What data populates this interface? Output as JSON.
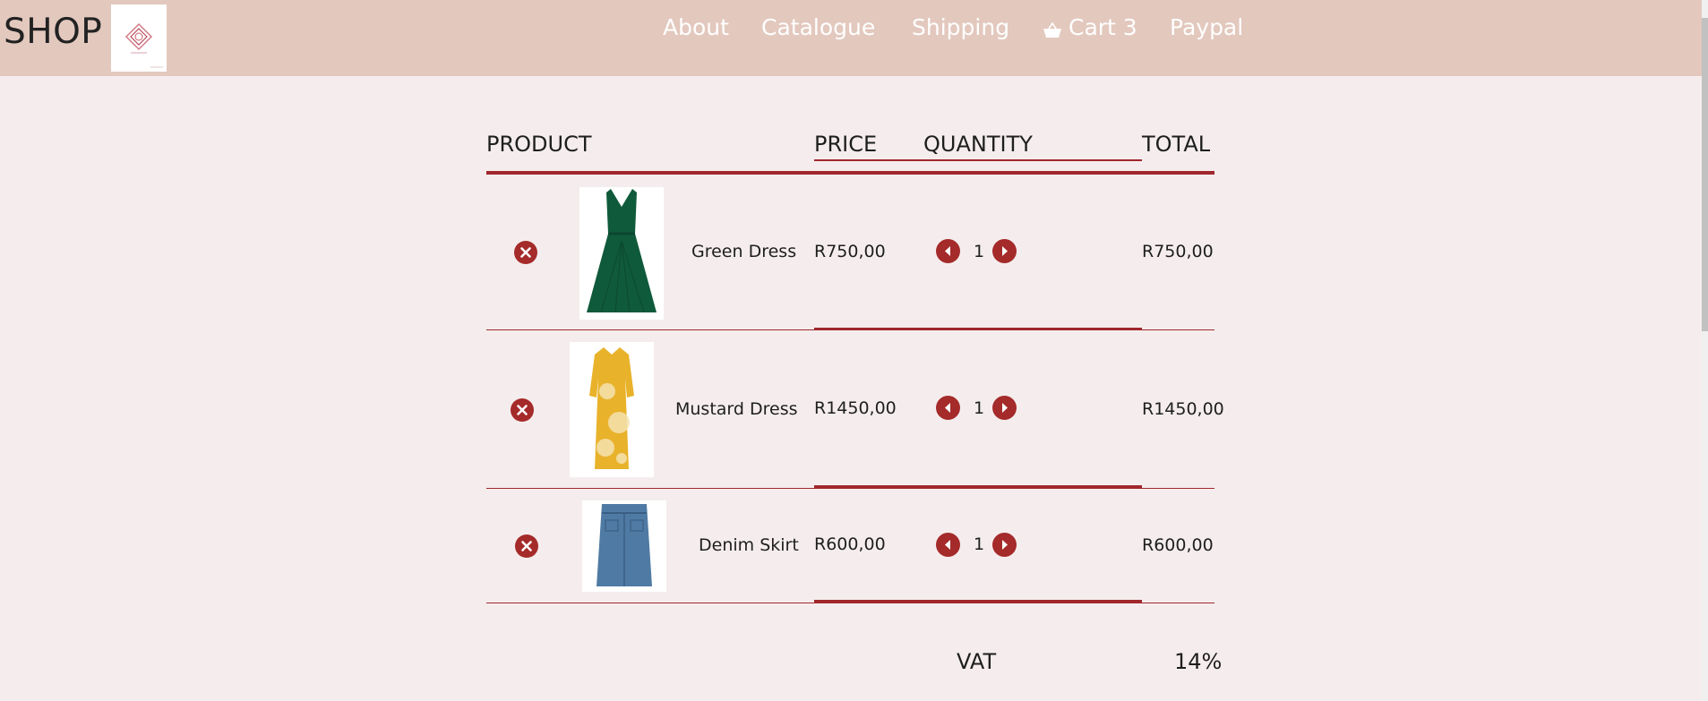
{
  "navbar": {
    "brand": "SHOP",
    "links": {
      "about": "About",
      "catalogue": "Catalogue",
      "shipping": "Shipping",
      "cart": "Cart 3",
      "paypal": "Paypal"
    }
  },
  "table": {
    "headers": {
      "product": "PRODUCT",
      "price": "PRICE",
      "quantity": "QUANTITY",
      "total": "TOTAL"
    },
    "rows": [
      {
        "name": "Green Dress",
        "price": "R750,00",
        "quantity": "1",
        "total": "R750,00",
        "image_color": "#0f5a3a"
      },
      {
        "name": "Mustard Dress",
        "price": "R1450,00",
        "quantity": "1",
        "total": "R1450,00",
        "image_color": "#e8b22a"
      },
      {
        "name": "Denim Skirt",
        "price": "R600,00",
        "quantity": "1",
        "total": "R600,00",
        "image_color": "#4f7aa3"
      }
    ]
  },
  "summary": {
    "vat_label": "VAT",
    "vat_value": "14%"
  },
  "theme": {
    "navbar_bg": "#e3c8be",
    "page_bg": "#f5eded",
    "accent": "#a52a2a"
  }
}
